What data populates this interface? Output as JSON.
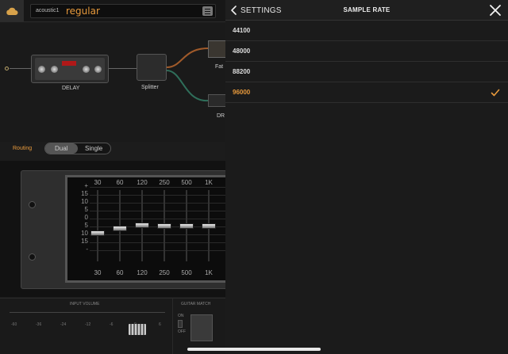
{
  "app": {
    "preset_folder": "acoustic1",
    "preset_name": "regular",
    "chain": {
      "delay_label": "DELAY",
      "splitter_label": "Splitter",
      "amp_top_label": "Fat",
      "amp_bottom_label": "DR"
    },
    "routing": {
      "label": "Routing",
      "options": [
        "Dual",
        "Single"
      ],
      "selected": "Dual"
    },
    "eq": {
      "bands": [
        "30",
        "60",
        "120",
        "250",
        "500",
        "1K"
      ],
      "scale": [
        "+",
        "15",
        "10",
        "5",
        "0",
        "5",
        "10",
        "15",
        "-"
      ],
      "band_levels_db": [
        -3.5,
        -1,
        0.5,
        0,
        0,
        0
      ]
    },
    "bottom": {
      "input_volume_title": "INPUT VOLUME",
      "vu_scale": [
        "-60",
        "-36",
        "-24",
        "-12",
        "-6",
        "0",
        "6"
      ],
      "guitar_match_title": "GUITAR MATCH",
      "switch_labels": [
        "ON",
        "OFF"
      ]
    }
  },
  "panel": {
    "back_label": "SETTINGS",
    "title": "SAMPLE RATE",
    "rates": [
      "44100",
      "48000",
      "88200",
      "96000"
    ],
    "selected_rate": "96000"
  },
  "colors": {
    "accent": "#e89a3c",
    "panel_bg": "#1b1b1b",
    "divider": "#2e2e2e"
  },
  "icons": {
    "back": "chevron-left-icon",
    "close": "close-icon",
    "selected": "checkmark-icon",
    "cloud": "cloud-icon",
    "menu": "menu-icon"
  }
}
